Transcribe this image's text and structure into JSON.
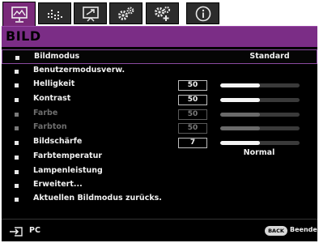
{
  "tabs": [
    {
      "icon": "picture-icon",
      "active": true
    },
    {
      "icon": "audio-icon",
      "active": false
    },
    {
      "icon": "display-icon",
      "active": false
    },
    {
      "icon": "settings-gears-icon",
      "active": false
    },
    {
      "icon": "advanced-settings-icon",
      "active": false
    },
    {
      "icon": "info-icon",
      "active": false
    }
  ],
  "header": {
    "title": "BILD"
  },
  "menu": {
    "items": [
      {
        "label": "Bildmodus",
        "value": "Standard",
        "selected": true
      },
      {
        "label": "Benutzermodusverw."
      },
      {
        "label": "Helligkeit",
        "number": "50",
        "level": 0.5
      },
      {
        "label": "Kontrast",
        "number": "50",
        "level": 0.5
      },
      {
        "label": "Farbe",
        "number": "50",
        "level": 0.5,
        "disabled": true
      },
      {
        "label": "Farbton",
        "number": "50",
        "level": 0.5,
        "disabled": true
      },
      {
        "label": "Bildschärfe",
        "number": "7",
        "level": 0.5
      },
      {
        "label": "Farbtemperatur",
        "value": "Normal"
      },
      {
        "label": "Lampenleistung"
      },
      {
        "label": "Erweitert..."
      },
      {
        "label": "Aktuellen Bildmodus zurücks."
      }
    ]
  },
  "footer": {
    "source_icon": "input-source-icon",
    "source": "PC",
    "back_key": "BACK",
    "exit_label": "Beenden"
  },
  "colors": {
    "accent": "#7b2d86",
    "background": "#000000",
    "text": "#f0f0f0",
    "disabled_text": "#6e6e6e"
  }
}
